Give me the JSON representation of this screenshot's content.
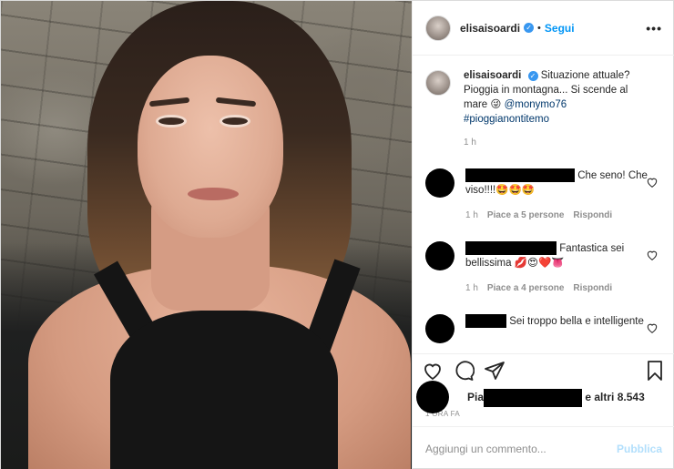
{
  "header": {
    "username": "elisaisoardi",
    "verified_badge": "✓",
    "separator": "•",
    "follow_label": "Segui",
    "more_label": "•••"
  },
  "caption": {
    "username": "elisaisoardi",
    "text_1": "Situazione attuale? Pioggia in montagna... Si scende al mare 😜 ",
    "mention": "@monymo76",
    "hashtag": "#pioggianontitemo",
    "time": "1 h"
  },
  "comments": [
    {
      "text": "Che seno! Che viso!!!!🤩🤩🤩",
      "time": "1 h",
      "likes": "Piace a 5 persone",
      "reply": "Rispondi"
    },
    {
      "text": "Fantastica sei bellissima 💋😍❤️👅",
      "time": "1 h",
      "likes": "Piace a 4 persone",
      "reply": "Rispondi"
    },
    {
      "text": "Sei troppo bella e intelligente"
    }
  ],
  "likes": {
    "prefix": "Pia",
    "text": "e altri 8.543",
    "ago": "1 ORA FA"
  },
  "add_comment": {
    "placeholder": "Aggiungi un commento...",
    "publish_label": "Pubblica"
  },
  "colors": {
    "accent": "#0095f6",
    "verified": "#3897f0",
    "publish_disabled": "#b2dffc",
    "muted_text": "#8e8e8e",
    "text": "#262626"
  },
  "icons": [
    "heart-icon",
    "comment-icon",
    "share-icon",
    "bookmark-icon",
    "more-icon",
    "verified-icon"
  ]
}
